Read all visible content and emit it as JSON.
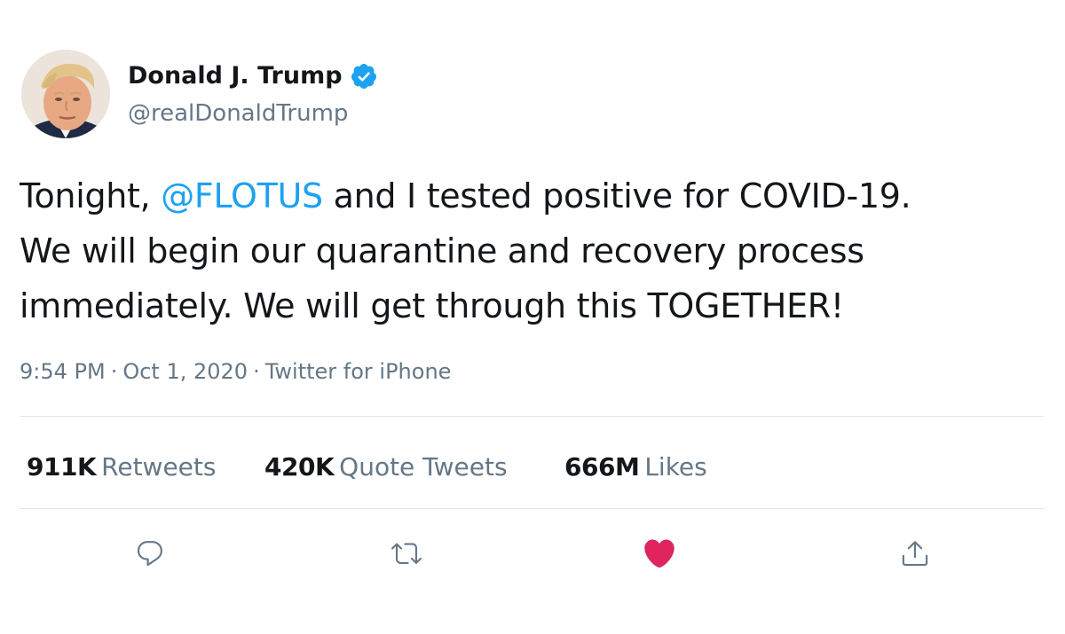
{
  "user": {
    "display_name": "Donald J. Trump",
    "handle": "@realDonaldTrump",
    "verified": true,
    "avatar_icon": "profile-photo"
  },
  "tweet": {
    "lines": [
      {
        "before": "Tonight, ",
        "mention": "@FLOTUS",
        "after": " and I tested positive for COVID-19."
      },
      {
        "text": "We will begin our quarantine and recovery process"
      },
      {
        "text": "immediately. We will get through this TOGETHER!"
      }
    ],
    "time": "9:54 PM",
    "date": "Oct 1, 2020",
    "source": "Twitter for iPhone",
    "separator": "·"
  },
  "stats": {
    "retweets": {
      "count": "911K",
      "label": "Retweets"
    },
    "quote_tweets": {
      "count": "420K",
      "label": "Quote Tweets"
    },
    "likes": {
      "count": "666M",
      "label": "Likes"
    }
  },
  "actions": [
    {
      "name": "reply",
      "icon": "speech-bubble-icon"
    },
    {
      "name": "retweet",
      "icon": "retweet-icon"
    },
    {
      "name": "like",
      "icon": "heart-icon",
      "active": true
    },
    {
      "name": "share",
      "icon": "share-icon"
    }
  ],
  "colors": {
    "accent": "#1da1f2",
    "like_active": "#e0245e",
    "secondary_text": "#657786",
    "primary_text": "#14171a",
    "divider": "#e1e8ed"
  }
}
